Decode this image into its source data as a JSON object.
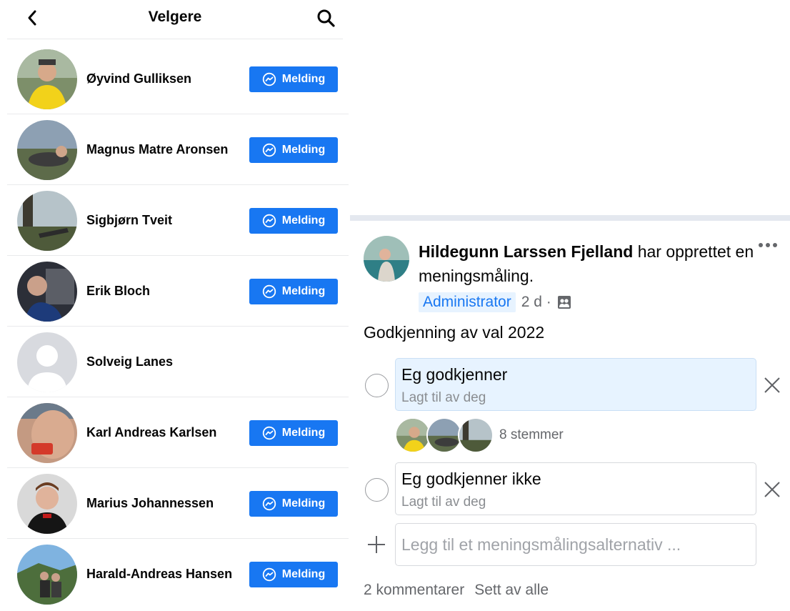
{
  "voters_list": {
    "title": "Velgere",
    "message_label": "Melding",
    "people": [
      {
        "name": "Øyvind Gulliksen",
        "has_message": true
      },
      {
        "name": "Magnus Matre Aronsen",
        "has_message": true
      },
      {
        "name": "Sigbjørn Tveit",
        "has_message": true
      },
      {
        "name": "Erik Bloch",
        "has_message": true
      },
      {
        "name": "Solveig Lanes",
        "has_message": false
      },
      {
        "name": "Karl Andreas Karlsen",
        "has_message": true
      },
      {
        "name": "Marius Johannessen",
        "has_message": true
      },
      {
        "name": "Harald-Andreas Hansen",
        "has_message": true
      }
    ]
  },
  "post": {
    "author": "Hildegunn Larssen Fjelland",
    "action": " har opprettet en meningsmåling.",
    "role_badge": "Administrator",
    "time": "2 d ·",
    "question": "Godkjenning av val 2022",
    "options": [
      {
        "title": "Eg godkjenner",
        "subtitle": "Lagt til av deg",
        "selected": true
      },
      {
        "title": "Eg godkjenner ikke",
        "subtitle": "Lagt til av deg",
        "selected": false
      }
    ],
    "votes_label": "8 stemmer",
    "add_option_placeholder": "Legg til et meningsmålingsalternativ ...",
    "comments": "2 kommentarer",
    "seen_by": "Sett av alle"
  },
  "colors": {
    "accent": "#1877f2",
    "selected_option_bg": "#e7f3ff",
    "secondary_text": "#65676b"
  },
  "icons": [
    "back-arrow-icon",
    "search-icon",
    "messenger-icon",
    "more-icon",
    "group-icon",
    "close-icon",
    "plus-icon"
  ]
}
